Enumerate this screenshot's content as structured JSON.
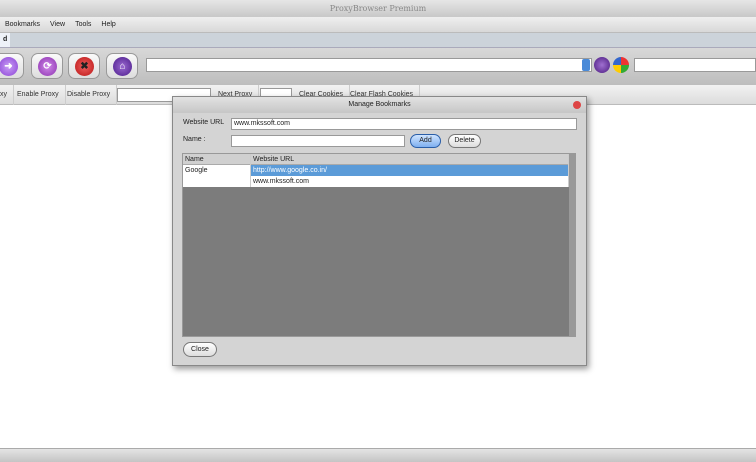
{
  "app": {
    "title": "ProxyBrowser Premium"
  },
  "menu": [
    "Bookmarks",
    "View",
    "Tools",
    "Help"
  ],
  "tab": {
    "label": "d"
  },
  "toolbar": {
    "url_value": "",
    "search_value": ""
  },
  "proxybar": {
    "items": [
      "xy",
      "Enable Proxy",
      "Disable Proxy",
      "Next Proxy",
      "Clear Cookies",
      "Clear Flash Cookies"
    ]
  },
  "dialog": {
    "title": "Manage Bookmarks",
    "url_label": "Website URL",
    "url_value": "www.mkssoft.com",
    "name_label": "Name :",
    "name_value": "",
    "add": "Add",
    "delete": "Delete",
    "close": "Close",
    "columns": [
      "Name",
      "Website URL"
    ],
    "rows": [
      {
        "name": "Google",
        "url": "http://www.google.co.in/"
      },
      {
        "name": "",
        "url": "www.mkssoft.com"
      }
    ]
  },
  "colors": {
    "selection": "#5b9bd8",
    "grid_bg": "#7c7c7c"
  }
}
